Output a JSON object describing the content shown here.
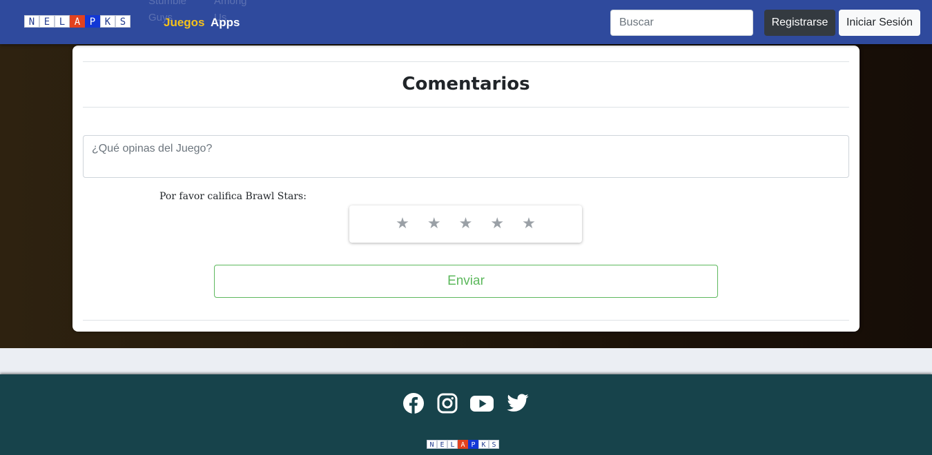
{
  "navbar": {
    "logo_letters": [
      "N",
      "E",
      "L",
      "A",
      "P",
      "K",
      "S"
    ],
    "ghost_links": [
      "Stumble Guys",
      "Among Us"
    ],
    "links": {
      "juegos": "Juegos",
      "apps": "Apps"
    },
    "search_placeholder": "Buscar",
    "register_label": "Registrarse",
    "login_label": "Iniciar Sesión"
  },
  "comments": {
    "title": "Comentarios",
    "input_placeholder": "¿Qué opinas del Juego?",
    "rate_label": "Por favor califica Brawl Stars:",
    "star_glyph": "★",
    "rating_max": 5,
    "rating_value": 0,
    "submit_label": "Enviar"
  },
  "footer": {
    "social_icons": [
      "facebook-icon",
      "instagram-icon",
      "youtube-icon",
      "twitter-icon"
    ],
    "logo_letters": [
      "N",
      "E",
      "L",
      "A",
      "P",
      "K",
      "S"
    ]
  },
  "colors": {
    "navbar_bg": "#2f4a9d",
    "accent_yellow": "#f6c21b",
    "submit_green": "#5cb85c",
    "footer_bg": "#17434b"
  }
}
